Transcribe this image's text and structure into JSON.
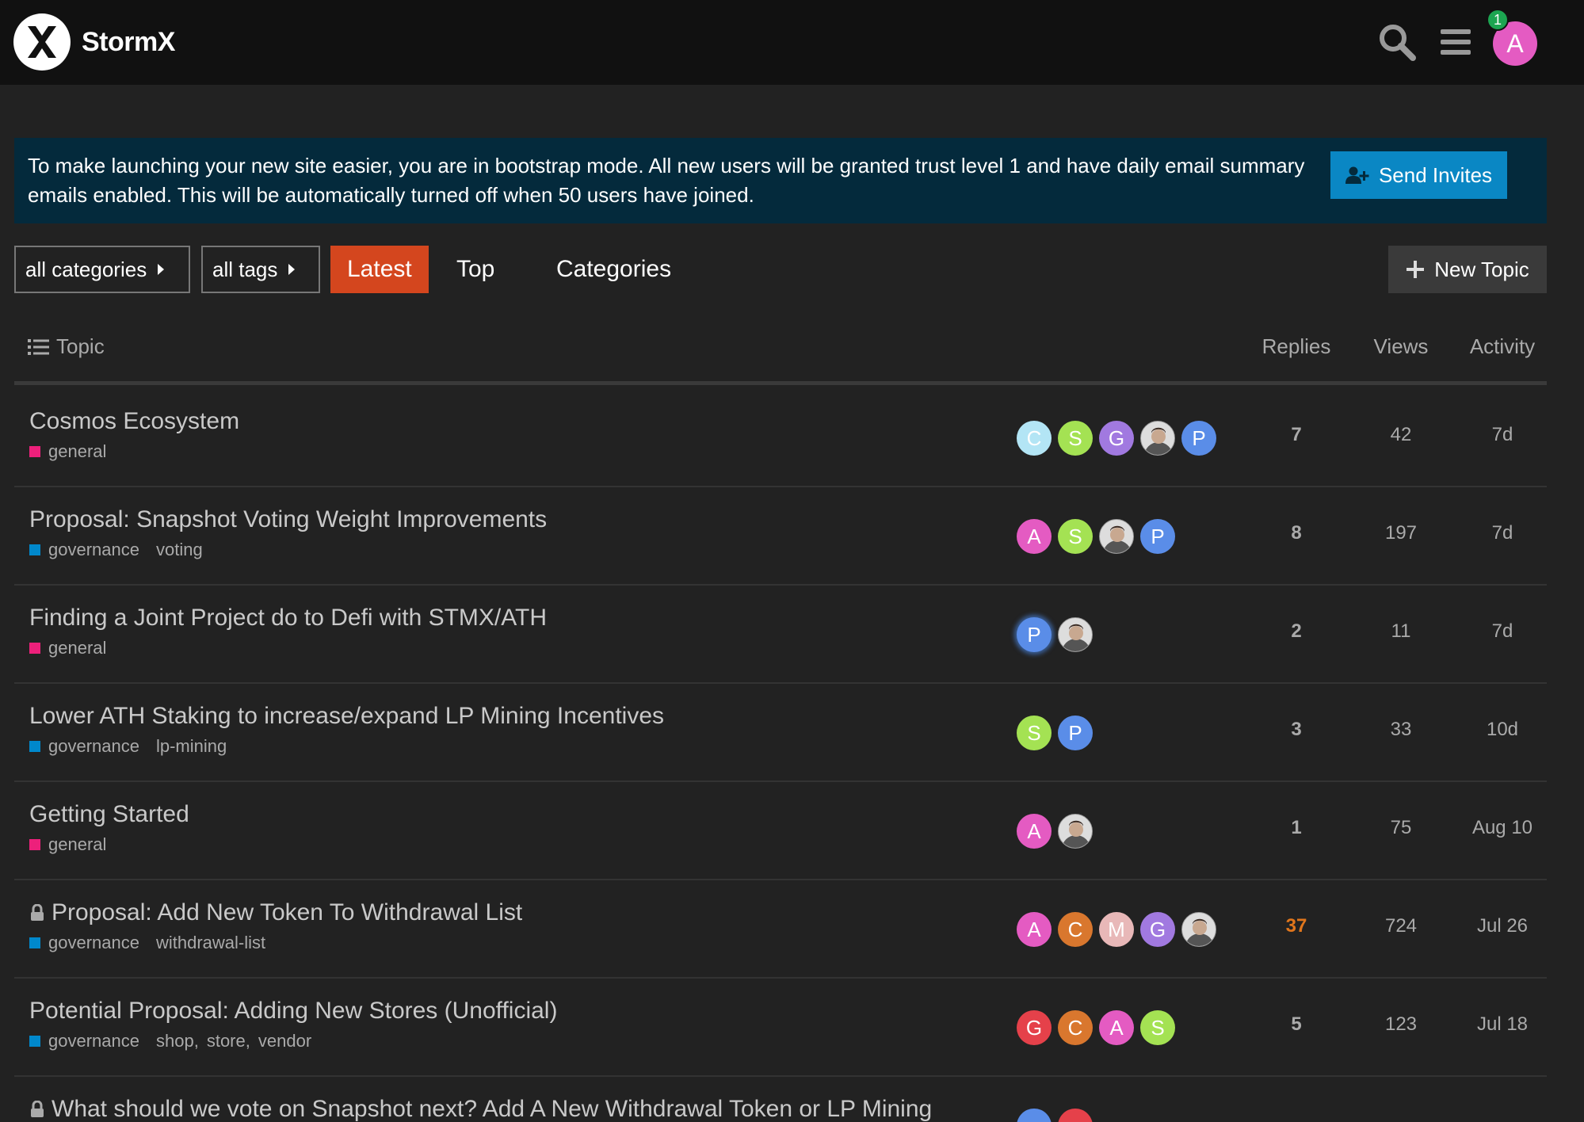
{
  "header": {
    "brand": "StormX",
    "notification_count": "1",
    "avatar_letter": "A",
    "icons": [
      "search-icon",
      "hamburger-menu-icon"
    ]
  },
  "banner": {
    "text": "To make launching your new site easier, you are in bootstrap mode. All new users will be granted trust level 1 and have daily email summary emails enabled. This will be automatically turned off when 50 users have joined.",
    "button_label": "Send Invites"
  },
  "nav": {
    "categories_dropdown": "all categories",
    "tags_dropdown": "all tags",
    "tabs": [
      {
        "label": "Latest",
        "active": true
      },
      {
        "label": "Top",
        "active": false
      },
      {
        "label": "Categories",
        "active": false
      }
    ],
    "new_topic_label": "New Topic"
  },
  "table": {
    "columns": {
      "topic": "Topic",
      "replies": "Replies",
      "views": "Views",
      "activity": "Activity"
    }
  },
  "colors": {
    "accent_latest": "#d4461e",
    "general": "#ed207b",
    "governance": "#0088cc",
    "hot_replies": "#e0761c"
  },
  "topics": [
    {
      "title": "Cosmos Ecosystem",
      "locked": false,
      "category": "general",
      "category_color": "#ed207b",
      "tags": [],
      "posters": [
        {
          "letter": "C",
          "color": "#b3e5f5"
        },
        {
          "letter": "S",
          "color": "#a4e253"
        },
        {
          "letter": "G",
          "color": "#a179e0"
        },
        {
          "letter": "",
          "color": "photo"
        },
        {
          "letter": "P",
          "color": "#5a8de8"
        }
      ],
      "replies": "7",
      "views": "42",
      "activity": "7d",
      "hot": false
    },
    {
      "title": "Proposal: Snapshot Voting Weight Improvements",
      "locked": false,
      "category": "governance",
      "category_color": "#0088cc",
      "tags": [
        "voting"
      ],
      "posters": [
        {
          "letter": "A",
          "color": "#e45bc2"
        },
        {
          "letter": "S",
          "color": "#a4e253"
        },
        {
          "letter": "",
          "color": "photo"
        },
        {
          "letter": "P",
          "color": "#5a8de8"
        }
      ],
      "replies": "8",
      "views": "197",
      "activity": "7d",
      "hot": false
    },
    {
      "title": "Finding a Joint Project do to Defi with STMX/ATH",
      "locked": false,
      "category": "general",
      "category_color": "#ed207b",
      "tags": [],
      "posters": [
        {
          "letter": "P",
          "color": "#5a8de8",
          "glow": true
        },
        {
          "letter": "",
          "color": "photo"
        }
      ],
      "replies": "2",
      "views": "11",
      "activity": "7d",
      "hot": false
    },
    {
      "title": "Lower ATH Staking to increase/expand LP Mining Incentives",
      "locked": false,
      "category": "governance",
      "category_color": "#0088cc",
      "tags": [
        "lp-mining"
      ],
      "posters": [
        {
          "letter": "S",
          "color": "#a4e253"
        },
        {
          "letter": "P",
          "color": "#5a8de8"
        }
      ],
      "replies": "3",
      "views": "33",
      "activity": "10d",
      "hot": false
    },
    {
      "title": "Getting Started",
      "locked": false,
      "category": "general",
      "category_color": "#ed207b",
      "tags": [],
      "posters": [
        {
          "letter": "A",
          "color": "#e45bc2"
        },
        {
          "letter": "",
          "color": "photo"
        }
      ],
      "replies": "1",
      "views": "75",
      "activity": "Aug 10",
      "hot": false
    },
    {
      "title": "Proposal: Add New Token To Withdrawal List",
      "locked": true,
      "category": "governance",
      "category_color": "#0088cc",
      "tags": [
        "withdrawal-list"
      ],
      "posters": [
        {
          "letter": "A",
          "color": "#e45bc2"
        },
        {
          "letter": "C",
          "color": "#d9772e"
        },
        {
          "letter": "M",
          "color": "#e8b8b8"
        },
        {
          "letter": "G",
          "color": "#a179e0"
        },
        {
          "letter": "",
          "color": "photo"
        }
      ],
      "replies": "37",
      "views": "724",
      "activity": "Jul 26",
      "hot": true
    },
    {
      "title": "Potential Proposal: Adding New Stores (Unofficial)",
      "locked": false,
      "category": "governance",
      "category_color": "#0088cc",
      "tags": [
        "shop",
        "store",
        "vendor"
      ],
      "posters": [
        {
          "letter": "G",
          "color": "#e5414a"
        },
        {
          "letter": "C",
          "color": "#d9772e"
        },
        {
          "letter": "A",
          "color": "#e45bc2"
        },
        {
          "letter": "S",
          "color": "#a4e253"
        }
      ],
      "replies": "5",
      "views": "123",
      "activity": "Jul 18",
      "hot": false
    },
    {
      "title": "What should we vote on Snapshot next? Add A New Withdrawal Token or LP Mining",
      "locked": true,
      "category": "",
      "category_color": "#0088cc",
      "tags": [],
      "posters": [
        {
          "letter": "",
          "color": "#5a8de8"
        },
        {
          "letter": "",
          "color": "#e5414a"
        }
      ],
      "replies": "",
      "views": "",
      "activity": "",
      "hot": false
    }
  ]
}
